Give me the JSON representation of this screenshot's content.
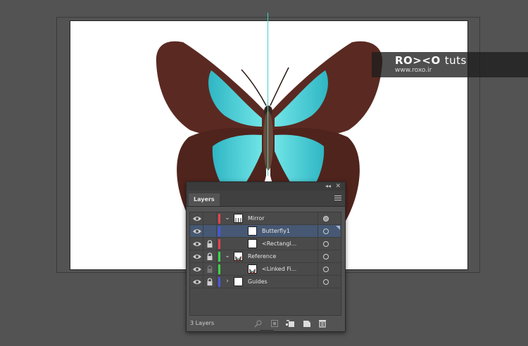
{
  "watermark": {
    "logo": "RO><O",
    "logo_suffix": "tuts",
    "url": "www.roxo.ir"
  },
  "layers_panel": {
    "tab_label": "Layers",
    "layer_count_label": "3 Layers",
    "rows": [
      {
        "name": "Mirror",
        "color": "#e8434c",
        "eye": true,
        "lock": false,
        "expandable": true,
        "expanded": true,
        "selected": false,
        "target": "filled"
      },
      {
        "name": "Butterfly1",
        "color": "#4a56e0",
        "eye": true,
        "lock": false,
        "expandable": false,
        "selected": true,
        "target": "empty"
      },
      {
        "name": "<Rectangl...",
        "color": "#e8434c",
        "eye": true,
        "lock": true,
        "expandable": false,
        "selected": false,
        "target": "empty"
      },
      {
        "name": "Reference",
        "color": "#3fd44a",
        "eye": true,
        "lock": true,
        "expandable": true,
        "expanded": true,
        "selected": false,
        "target": "empty"
      },
      {
        "name": "<Linked Fi...",
        "color": "#3fd44a",
        "eye": true,
        "lock": true,
        "expandable": false,
        "selected": false,
        "target": "empty"
      },
      {
        "name": "Guides",
        "color": "#4a56e0",
        "eye": true,
        "lock": true,
        "expandable": true,
        "expanded": false,
        "selected": false,
        "target": "empty"
      }
    ]
  },
  "colors": {
    "guide": "#3ed3c6",
    "selection": "#465873",
    "wing_brown": "#5a2a22",
    "wing_cyan": "#3fc9d2"
  }
}
